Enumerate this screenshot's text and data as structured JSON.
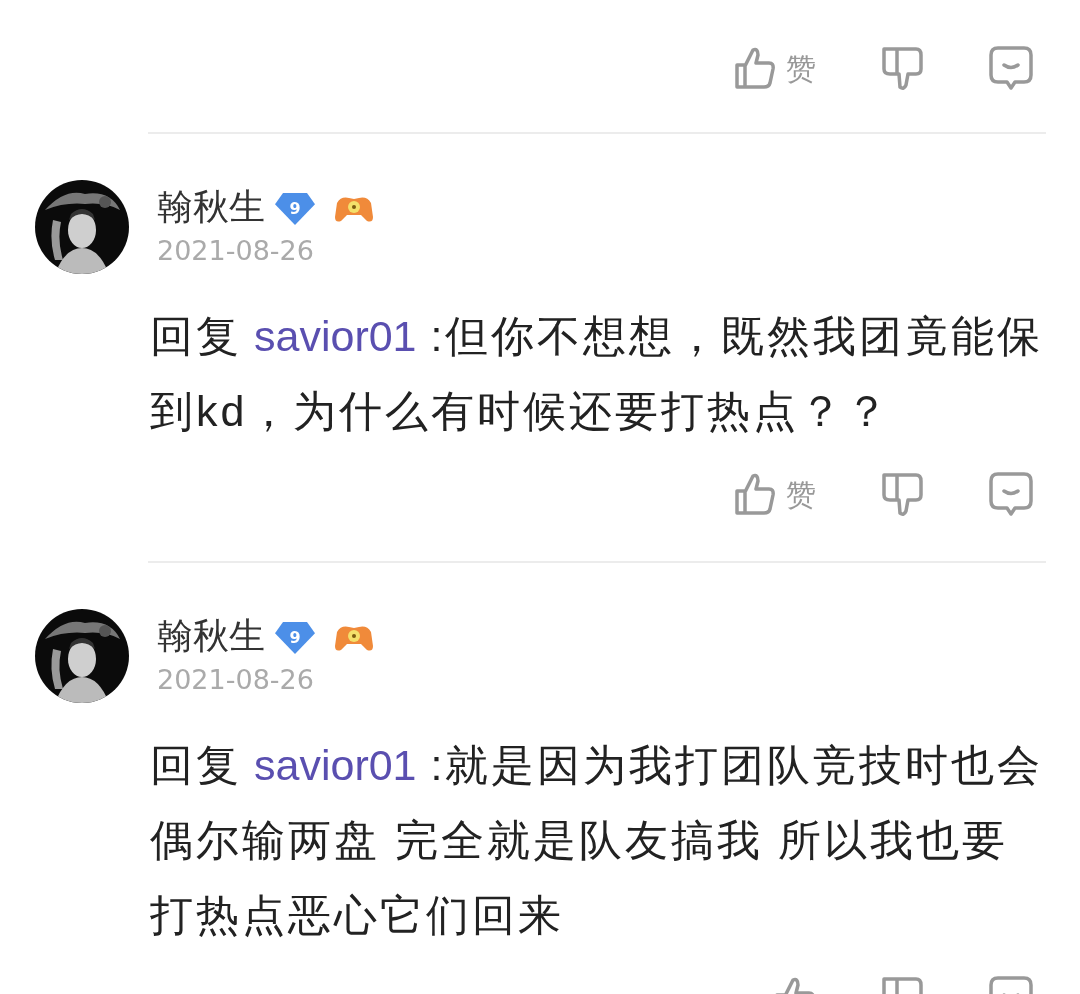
{
  "top_actions": {
    "like_label": "赞"
  },
  "comments": [
    {
      "name": "翰秋生",
      "level": "9",
      "date": "2021-08-26",
      "reply_prefix": "回复",
      "reply_to": "savior01",
      "text": ":但你不想想，既然我团竟能保到kd，为什么有时候还要打热点？？",
      "actions": {
        "like_label": "赞"
      }
    },
    {
      "name": "翰秋生",
      "level": "9",
      "date": "2021-08-26",
      "reply_prefix": "回复",
      "reply_to": "savior01",
      "text": ":就是因为我打团队竞技时也会偶尔输两盘 完全就是队友搞我 所以我也要打热点恶心它们回来"
    }
  ]
}
